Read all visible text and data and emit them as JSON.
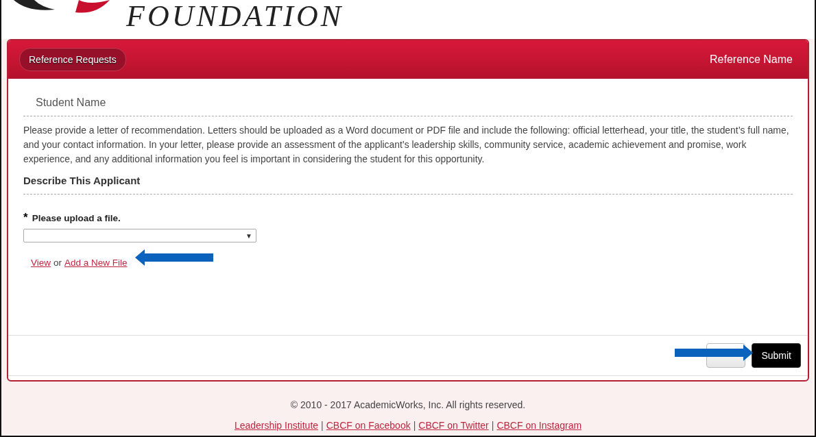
{
  "logo": {
    "text": "FOUNDATION"
  },
  "header": {
    "back_button": "Reference Requests",
    "title": "Reference Name"
  },
  "student": "Student Name",
  "instructions": "Please provide a letter of recommendation. Letters should be uploaded as a Word document or PDF file and include the following: official letterhead, your title, the student’s full name, and your contact information. In your letter, please provide an assessment of the applicant’s leadership skills, community service, academic achievement and promise, work experience, and any additional information you feel is important in considering the student for this opportunity.",
  "section_title": "Describe This Applicant",
  "upload": {
    "required_mark": "*",
    "label": "Please upload a file.",
    "dropdown_caret": "▼",
    "links": [
      {
        "text": "View",
        "kind": "link"
      },
      {
        "text": "or",
        "kind": "text"
      },
      {
        "text": "Add a New File",
        "kind": "link"
      }
    ]
  },
  "buttons": [
    {
      "kind": "secondary"
    },
    {
      "kind": "primary",
      "label": "Submit"
    }
  ],
  "footer": {
    "copyright": "© 2010 - 2017 AcademicWorks, Inc. All rights reserved.",
    "links": [
      "Leadership Institute",
      "CBCF on Facebook",
      "CBCF on Twitter",
      "CBCF on Instagram"
    ],
    "separator": "|"
  }
}
